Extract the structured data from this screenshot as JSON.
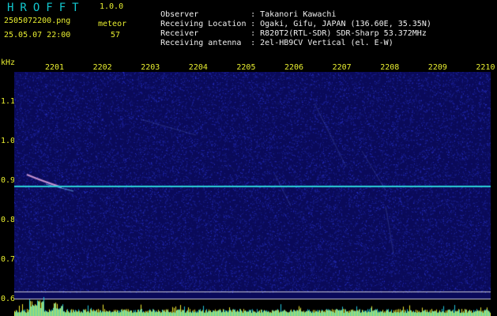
{
  "header": {
    "app_title": "HROFFT",
    "app_version": "1.0.0",
    "file_name": "2505072200.png",
    "datetime": "25.05.07 22:00",
    "meteor_label": "meteor",
    "meteor_count": "57"
  },
  "info": [
    {
      "key": "Observer",
      "value": ": Takanori Kawachi"
    },
    {
      "key": "Receiving Location",
      "value": ": Ogaki, Gifu, JAPAN (136.60E, 35.35N)"
    },
    {
      "key": "Receiver",
      "value": ": R820T2(RTL-SDR) SDR-Sharp 53.372MHz"
    },
    {
      "key": "Receiving antenna",
      "value": ": 2el-HB9CV Vertical (el. E-W)"
    }
  ],
  "axis": {
    "y_unit": "kHz",
    "x_ticks": [
      "2201",
      "2202",
      "2203",
      "2204",
      "2205",
      "2206",
      "2207",
      "2208",
      "2209",
      "2210"
    ],
    "y_ticks": [
      "1.1",
      "1.0",
      "0.9",
      "0.8",
      "0.7",
      "0.6"
    ]
  },
  "colors": {
    "background": "#000000",
    "spectrogram": "#0a0a5a",
    "carrier_line": "#2ad0d8",
    "tick_text": "#e8ee30",
    "title_text": "#12c8d0"
  }
}
